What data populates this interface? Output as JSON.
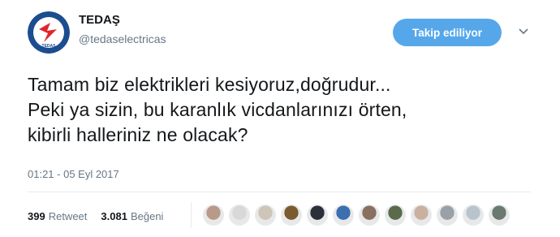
{
  "account": {
    "name": "TEDAŞ",
    "handle": "@tedaselectricas",
    "logo_text": "TEDAŞ",
    "follow_label": "Takip ediliyor"
  },
  "tweet": {
    "lines": [
      "Tamam biz elektrikleri kesiyoruz,doğrudur...",
      "Peki ya sizin, bu karanlık vicdanlarınızı örten,",
      "kibirli halleriniz ne olacak?"
    ],
    "timestamp": "01:21 - 05 Eyl 2017"
  },
  "stats": {
    "retweets_count": "399",
    "retweets_label": "Retweet",
    "likes_count": "3.081",
    "likes_label": "Beğeni"
  },
  "likers": [
    {
      "color": "#b89a8a"
    },
    {
      "color": "#d8d8d8"
    },
    {
      "color": "#cfc4b8"
    },
    {
      "color": "#7a5a30"
    },
    {
      "color": "#2b2f3a"
    },
    {
      "color": "#3a6fb0"
    },
    {
      "color": "#8a7060"
    },
    {
      "color": "#5a6a4a"
    },
    {
      "color": "#c9b0a0"
    },
    {
      "color": "#9aa0a8"
    },
    {
      "color": "#b8c4cc"
    },
    {
      "color": "#6a7a70"
    }
  ],
  "colors": {
    "follow_button": "#56a7ea",
    "logo_blue": "#1b4d8f",
    "logo_red": "#e0262b"
  },
  "icons": {
    "caret": "chevron-down-icon"
  }
}
